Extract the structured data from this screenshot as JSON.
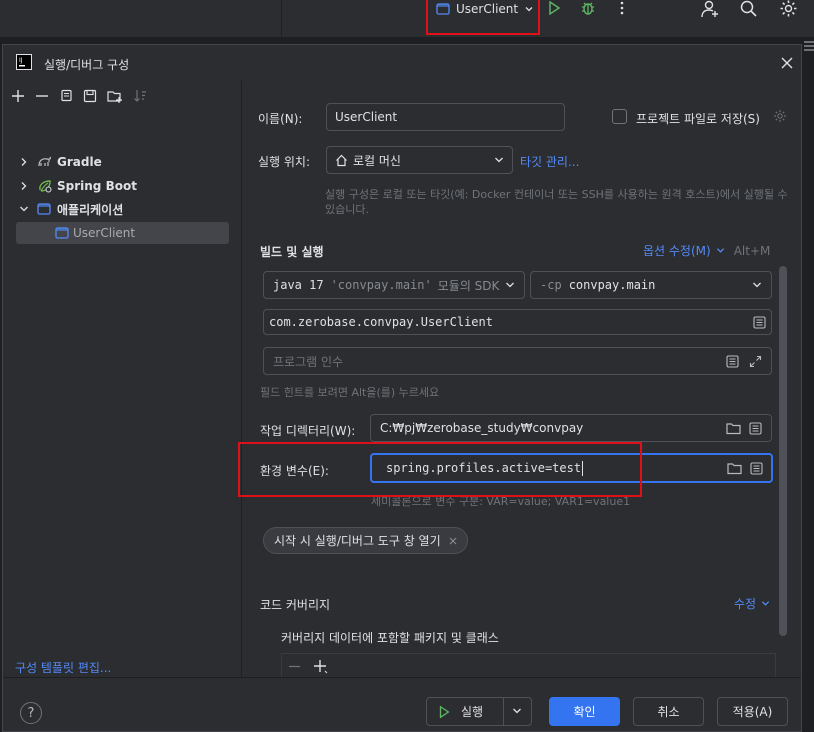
{
  "toolbar": {
    "run_config_name": "UserClient"
  },
  "dialog": {
    "title": "실행/디버그 구성",
    "footer": {
      "edit_templates_link": "구성 템플릿 편집...",
      "run_label": "실행",
      "ok_label": "확인",
      "cancel_label": "취소",
      "apply_label": "적용(A)"
    }
  },
  "tree": {
    "items": [
      {
        "label": "Gradle"
      },
      {
        "label": "Spring Boot"
      },
      {
        "label": "애플리케이션"
      },
      {
        "label": "UserClient"
      }
    ]
  },
  "form": {
    "name_label": "이름(N):",
    "name_value": "UserClient",
    "store_as_project_file": "프로젝트 파일로 저장(S)",
    "run_on_label": "실행 위치:",
    "run_on_value": "로컬 머신",
    "manage_targets_link": "타깃 관리...",
    "run_on_hint": "실행 구성은 로컬 또는 타깃(예: Docker 컨테이너 또는 SSH를 사용하는 원격 호스트)에서 실행될 수 있습니다.",
    "build_run_title": "빌드 및 실행",
    "modify_options_link": "옵션 수정(M)",
    "modify_options_shortcut": "Alt+M",
    "jdk_value_prefix": "java 17",
    "jdk_value_module": "'convpay.main'",
    "jdk_value_suffix": "모듈의 SDK",
    "classpath_prefix": "-cp",
    "classpath_value": "convpay.main",
    "main_class_value": "com.zerobase.convpay.UserClient",
    "program_args_placeholder": "프로그램 인수",
    "field_hint": "필드 힌트를 보려면 Alt을(를) 누르세요",
    "working_dir_label": "작업 디렉터리(W):",
    "working_dir_value": "C:₩pj₩zerobase_study₩convpay",
    "env_vars_label": "환경 변수(E):",
    "env_vars_value": "spring.profiles.active=test",
    "env_vars_hint": "세미콜론으로 변수 구분: VAR=value; VAR1=value1",
    "open_tool_window_chip": "시작 시 실행/디버그 도구 창 열기",
    "coverage_title": "코드 커버리지",
    "coverage_modify_link": "수정",
    "coverage_packages_label": "커버리지 데이터에 포함할 패키지 및 클래스"
  }
}
